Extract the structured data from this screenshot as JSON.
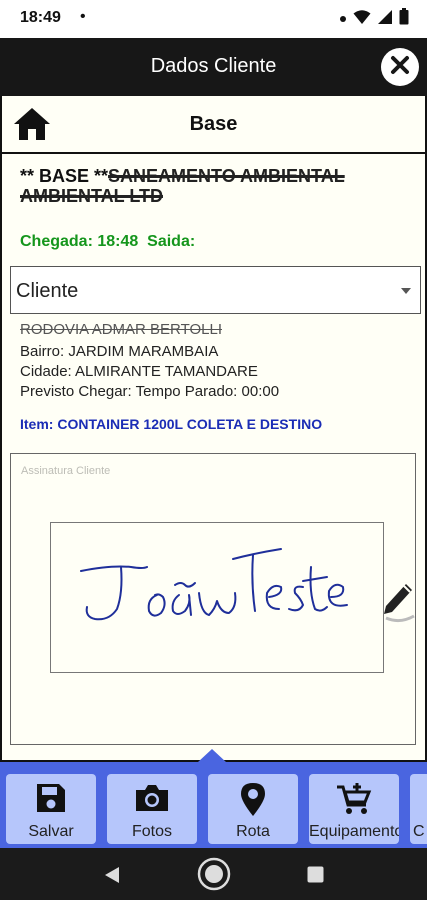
{
  "status_bar": {
    "time": "18:49",
    "dot": "•",
    "icons": [
      "notification-dot-icon",
      "wifi-icon",
      "signal-icon",
      "battery-icon"
    ]
  },
  "header": {
    "title": "Dados Cliente",
    "close_icon": "close-icon"
  },
  "base_bar": {
    "home_icon": "home-icon",
    "title": "Base"
  },
  "client": {
    "name_prefix": "** BASE **",
    "name_struck_1": "SANEAMENTO AMBIENTAL",
    "name_struck_2": "AMBIENTAL LTD",
    "arrival_label": "Chegada: 18:48",
    "departure_label": "Saida:"
  },
  "dropdown": {
    "selected": "Cliente"
  },
  "address": {
    "street": "RODOVIA ADMAR BERTOLLI",
    "bairro": "Bairro: JARDIM MARAMBAIA",
    "cidade": "Cidade: ALMIRANTE TAMANDARE",
    "previsto": "Previsto Chegar:  Tempo Parado: 00:00"
  },
  "item": "Item: CONTAINER 1200L COLETA E DESTINO",
  "signature": {
    "label": "Assinatura Cliente",
    "signed_text": "João Teste",
    "edit_icon": "pencil-icon"
  },
  "bottom_nav": [
    {
      "label": "Salvar",
      "icon": "save-icon"
    },
    {
      "label": "Fotos",
      "icon": "camera-icon"
    },
    {
      "label": "Rota",
      "icon": "map-pin-icon"
    },
    {
      "label": "Equipamentos",
      "icon": "cart-plus-icon"
    },
    {
      "label": "C",
      "icon": "more-icon"
    }
  ],
  "system_nav": {
    "back": "back-icon",
    "home": "home-circle-icon",
    "recents": "recents-icon"
  },
  "colors": {
    "header_bg": "#171717",
    "screen_bg": "#fffff6",
    "arrival_green": "#15961c",
    "item_blue": "#1b2db5",
    "nav_bg": "#4a65e0",
    "nav_button": "#b6c6fb",
    "signature_ink": "#1f2f9a"
  }
}
